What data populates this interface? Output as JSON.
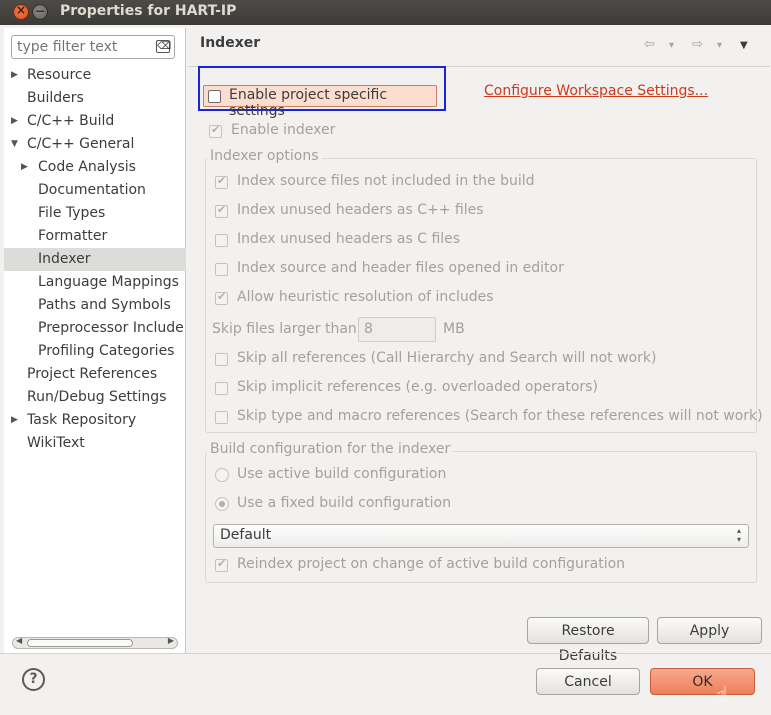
{
  "window": {
    "title": "Properties for HART-IP",
    "close_glyph": "×",
    "min_glyph": "−"
  },
  "sidebar": {
    "filter_placeholder": "type filter text",
    "filter_clear_glyph": "⌫",
    "items": [
      {
        "label": "Resource",
        "arrow": "▶",
        "indent": 0
      },
      {
        "label": "Builders",
        "arrow": "",
        "indent": 0
      },
      {
        "label": "C/C++ Build",
        "arrow": "▶",
        "indent": 0
      },
      {
        "label": "C/C++ General",
        "arrow": "▼",
        "indent": 0
      },
      {
        "label": "Code Analysis",
        "arrow": "▶",
        "indent": 1
      },
      {
        "label": "Documentation",
        "arrow": "",
        "indent": 1
      },
      {
        "label": "File Types",
        "arrow": "",
        "indent": 1
      },
      {
        "label": "Formatter",
        "arrow": "",
        "indent": 1
      },
      {
        "label": "Indexer",
        "arrow": "",
        "indent": 1,
        "selected": true
      },
      {
        "label": "Language Mappings",
        "arrow": "",
        "indent": 1
      },
      {
        "label": "Paths and Symbols",
        "arrow": "",
        "indent": 1
      },
      {
        "label": "Preprocessor Include",
        "arrow": "",
        "indent": 1
      },
      {
        "label": "Profiling Categories",
        "arrow": "",
        "indent": 1
      },
      {
        "label": "Project References",
        "arrow": "",
        "indent": 0
      },
      {
        "label": "Run/Debug Settings",
        "arrow": "",
        "indent": 0
      },
      {
        "label": "Task Repository",
        "arrow": "▶",
        "indent": 0
      },
      {
        "label": "WikiText",
        "arrow": "",
        "indent": 0
      }
    ]
  },
  "page": {
    "title": "Indexer",
    "nav": {
      "back": "⇦",
      "back_menu": "▾",
      "forward": "⇨",
      "forward_menu": "▾",
      "menu": "▼"
    },
    "enable_project_specific": {
      "label": "Enable project specific settings",
      "checked": false
    },
    "configure_workspace_link": "Configure Workspace Settings...",
    "enable_indexer": {
      "label": "Enable indexer",
      "checked": true
    },
    "indexer_options": {
      "title": "Indexer options",
      "options": [
        {
          "label": "Index source files not included in the build",
          "checked": true
        },
        {
          "label": "Index unused headers as C++ files",
          "checked": true
        },
        {
          "label": "Index unused headers as C files",
          "checked": false
        },
        {
          "label": "Index source and header files opened in editor",
          "checked": false
        },
        {
          "label": "Allow heuristic resolution of includes",
          "checked": true
        }
      ],
      "skip_files_label": "Skip files larger than:",
      "skip_files_value": "8",
      "skip_files_unit": "MB",
      "skip_options": [
        {
          "label": "Skip all references (Call Hierarchy and Search will not work)",
          "checked": false
        },
        {
          "label": "Skip implicit references (e.g. overloaded operators)",
          "checked": false
        },
        {
          "label": "Skip type and macro references (Search for these references will not work)",
          "checked": false
        }
      ]
    },
    "build_config": {
      "title": "Build configuration for the indexer",
      "options": [
        {
          "label": "Use active build configuration",
          "selected": false
        },
        {
          "label": "Use a fixed build configuration",
          "selected": true
        }
      ],
      "combo_value": "Default",
      "combo_caret": "▴▾",
      "reindex": {
        "label": "Reindex project on change of active build configuration",
        "checked": true
      }
    },
    "restore_defaults": "Restore Defaults",
    "apply": "Apply"
  },
  "footer": {
    "help": "?",
    "cancel": "Cancel",
    "ok": "OK"
  }
}
